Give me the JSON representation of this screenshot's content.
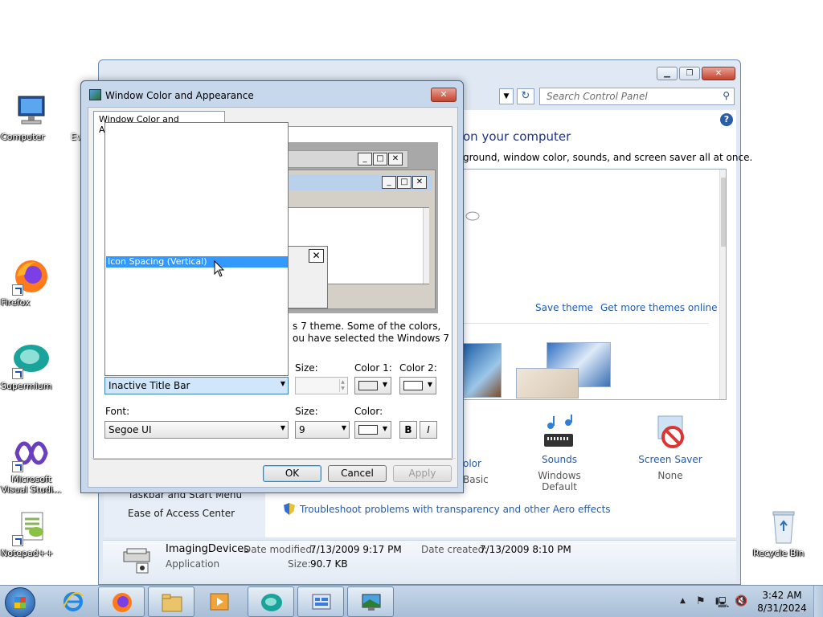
{
  "desktop": {
    "icons": [
      {
        "label": "Computer"
      },
      {
        "label": "Firefox"
      },
      {
        "label": "Supermium"
      },
      {
        "label": "Microsoft Visual Studi..."
      },
      {
        "label": "Notepad++"
      },
      {
        "label": "Recycle Bin"
      }
    ],
    "partial_label": "Ev"
  },
  "control_panel": {
    "search_placeholder": "Search Control Panel",
    "heading": "on your computer",
    "subheading": "ground, window color, sounds, and screen saver all at once.",
    "save_theme": "Save theme",
    "more_themes": "Get more themes online",
    "items": [
      {
        "title": "olor",
        "subtitle": "Basic"
      },
      {
        "title": "Sounds",
        "subtitle": "Windows Default"
      },
      {
        "title": "Screen Saver",
        "subtitle": "None"
      }
    ],
    "left_links": {
      "taskbar": "Taskbar and Start Menu",
      "ease": "Ease of Access Center"
    },
    "troubleshoot": "Troubleshoot problems with transparency and other Aero effects",
    "details": {
      "name": "ImagingDevices",
      "type": "Application",
      "date_modified_label": "Date modified:",
      "date_modified": "7/13/2009 9:17 PM",
      "date_created_label": "Date created:",
      "date_created": "7/13/2009 8:10 PM",
      "size_label": "Size:",
      "size": "90.7 KB"
    }
  },
  "dialog": {
    "title": "Window Color and Appearance",
    "tab_label": "Window Color and Appearance",
    "description_line1": "s 7 theme.  Some of the colors,",
    "description_line2": "ou have selected the Windows 7",
    "item_list_selected": "Icon Spacing (Vertical)",
    "item_combo_value": "Inactive Title Bar",
    "size_label": "Size:",
    "color1_label": "Color 1:",
    "color2_label": "Color 2:",
    "font_label": "Font:",
    "font_value": "Segoe UI",
    "font_size_label": "Size:",
    "font_size_value": "9",
    "font_color_label": "Color:",
    "bold_label": "B",
    "italic_label": "I",
    "ok": "OK",
    "cancel": "Cancel",
    "apply": "Apply",
    "colors": {
      "color1": "#ececec",
      "color2": "#ffffff",
      "font_color": "#ffffff"
    }
  },
  "taskbar": {
    "time": "3:42 AM",
    "date": "8/31/2024",
    "buttons": [
      "internet-explorer",
      "firefox",
      "file-explorer",
      "media-player",
      "supermium",
      "control-panel",
      "window-color-appearance"
    ]
  }
}
